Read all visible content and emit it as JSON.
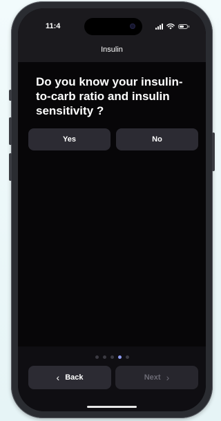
{
  "status_bar": {
    "time": "11:4",
    "icons": [
      "signal-icon",
      "wifi-icon",
      "battery-icon"
    ]
  },
  "header": {
    "title": "Insulin"
  },
  "question": {
    "text": "Do you know your insulin-to-carb ratio and insulin sensitivity ?"
  },
  "choices": {
    "yes_label": "Yes",
    "no_label": "No"
  },
  "pagination": {
    "total": 5,
    "current": 4
  },
  "navigation": {
    "back_label": "Back",
    "next_label": "Next",
    "back_icon": "chevron-left-icon",
    "next_icon": "chevron-right-icon",
    "next_enabled": false
  },
  "colors": {
    "background": "#070608",
    "button": "#2c2b33",
    "active_dot": "#8e9cf2",
    "text": "#ffffff",
    "disabled_text": "#6c6b75"
  }
}
